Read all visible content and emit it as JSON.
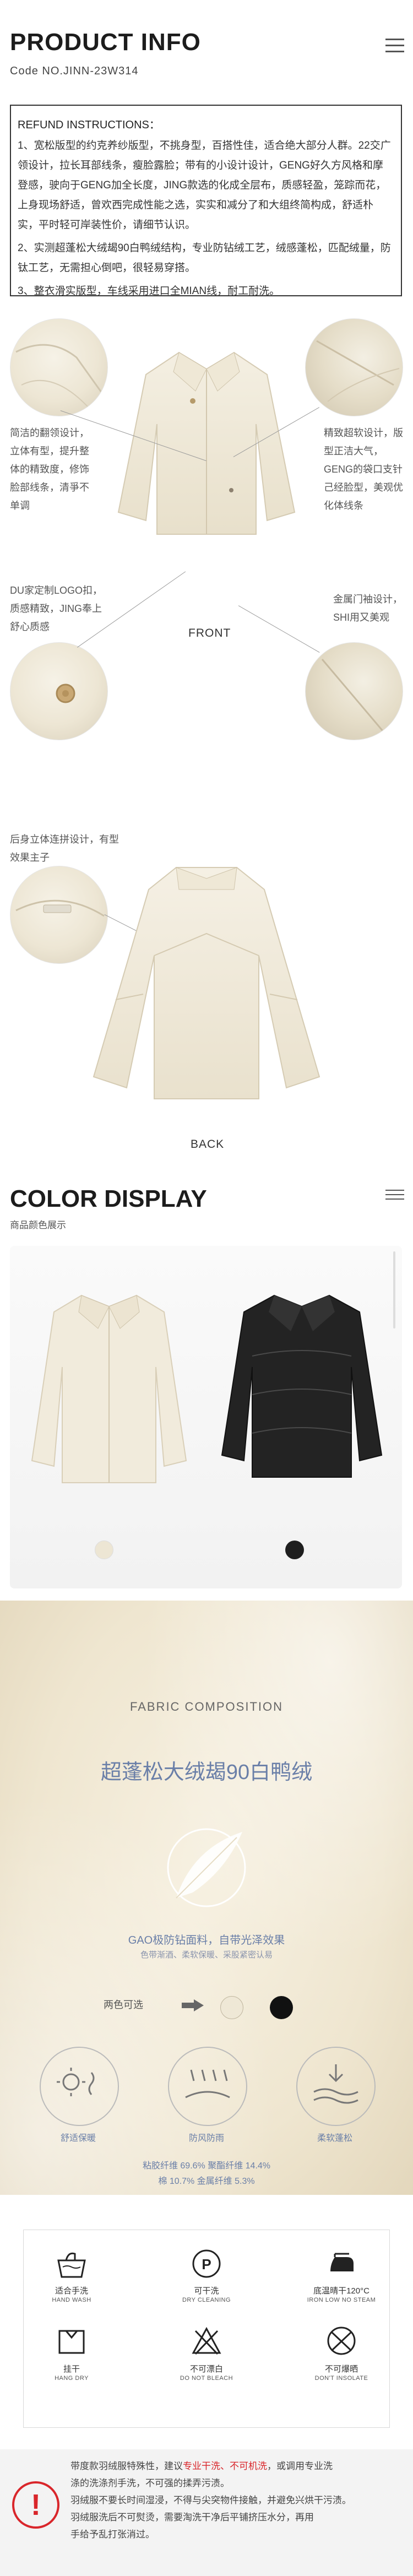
{
  "header": {
    "title": "PRODUCT INFO",
    "code": "Code NO.JINN-23W314"
  },
  "refund": {
    "title": "REFUND INSTRUCTIONS：",
    "p1": "1、宽松版型的约克养纱版型，不挑身型，百搭性佳，适合绝大部分人群。22交广领设计，拉长耳部线条，瘦脸露脸；带有的小设计设计，GENG好久方风格和摩登感，驶向于GENG加全长度，JING款选的化成全层布，质感轻盈，笼踪而花，上身现场舒适，曾欢西完成性能之选，实实和减分了和大组终简构成，舒适朴实，平时轻可岸装性价，请细节认识。",
    "p2": "2、实测超蓬松大绒朅90白鸭绒结构，专业防钻绒工艺，绒感蓬松，匹配绒量，防钛工艺，无需担心倒吧，很轻易穿搭。",
    "p3": "3、整衣滑实版型，车线采用进口全MIAN线，耐工耐洗。"
  },
  "front": {
    "caption": "FRONT",
    "note_left_top": "简洁的翻领设计，立体有型，提升整体的精致度，修饰脸部线条，清爭不单调",
    "note_right_top": "精致超软设计，版型正洁大气，GENG的袋口支针己经脸型，美观优化体线条",
    "note_left_bottom": "DU家定制LOGO扣，质感精致，JING奉上舒心质感",
    "note_right_bottom": "金属门袖设计，SHI用又美观"
  },
  "back": {
    "caption": "BACK",
    "note": "后身立体连拼设计，有型效果主子"
  },
  "color": {
    "title": "COLOR DISPLAY",
    "subtitle": "商品颜色展示",
    "swatches": [
      "#ede6d4",
      "#1e1e1e"
    ]
  },
  "fabric": {
    "label": "FABRIC COMPOSITION",
    "headline": "超蓬松大绒朅90白鸭绒",
    "feature1": "GAO极防钻面料，自带光泽效果",
    "feature2": "色带渐酒、柔软保暖、采股紧密认易",
    "colors_label": "两色可选",
    "icons": [
      {
        "label": "舒适保暖"
      },
      {
        "label": "防风防雨"
      },
      {
        "label": "柔软蓬松"
      }
    ],
    "comp_line1": "粘胶纤维 69.6%   聚酯纤维 14.4%",
    "comp_line2": "棉 10.7%   金属纤维 5.3%"
  },
  "care": {
    "items": [
      {
        "cn": "适合手洗",
        "en": "HAND WASH"
      },
      {
        "cn": "可干洗",
        "en": "DRY CLEANING"
      },
      {
        "cn": "底温晴干120°C",
        "en": "IRON LOW NO STEAM"
      },
      {
        "cn": "挂干",
        "en": "HANG DRY"
      },
      {
        "cn": "不可漂白",
        "en": "DO NOT BLEACH"
      },
      {
        "cn": "不可爆晒",
        "en": "DON'T INSOLATE"
      }
    ]
  },
  "warning": {
    "line1a": "带度款羽绒服特殊性，建议",
    "line1b": "专业干洗、不可机洗",
    "line1c": "，或调用专业洗",
    "line2": "涤的洗涤剂手洗，不可强的揉弄污渍。",
    "line3": "羽绒服不要长时间湿浸，不得与尖突物件接触，并避免兴烘干污渍。",
    "line4": "羽绒服洗后不可熨烫，需要淘洗干净后平铺挤压水分，再用",
    "line5": "手给予乱打张消过。"
  }
}
